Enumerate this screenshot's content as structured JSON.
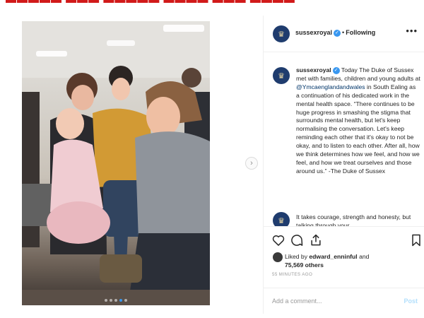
{
  "post": {
    "carousel": {
      "slide_count": 5,
      "active_index": 3
    }
  },
  "header": {
    "username": "sussexroyal",
    "separator": "•",
    "follow_state": "Following",
    "more_glyph": "•••",
    "avatar_glyph": "♛"
  },
  "caption": {
    "username": "sussexroyal",
    "text_before_mention": " Today The Duke of Sussex met with families, children and young adults at ",
    "mention": "@Ymcaenglandandwales",
    "text_after_mention": " in South Ealing as a continuation of his dedicated work in the mental health space. “There continues to be huge progress in smashing the stigma that surrounds mental health, but let's keep normalising the conversation. Let's keep reminding each other that it's okay to not be okay, and to listen to each other. After all, how we think determines how we feel, and how we feel, and how we treat ourselves and those around us.” -The Duke of Sussex"
  },
  "comment": {
    "text": "It takes courage, strength and honesty, but talking through your"
  },
  "likes": {
    "prefix": "Liked by ",
    "user": "edward_enninful",
    "joiner": " and",
    "count": "75,569 others"
  },
  "timestamp": "55 MINUTES AGO",
  "add_comment": {
    "placeholder": "Add a comment...",
    "post_label": "Post"
  },
  "icons": {
    "verified": "verified-badge-icon",
    "next": "chevron-right-icon",
    "like": "heart-icon",
    "comment": "comment-icon",
    "share": "share-icon",
    "save": "bookmark-icon"
  },
  "colors": {
    "link": "#003569",
    "verified": "#3897f0",
    "post_disabled": "#b2dffc",
    "timestamp": "#999999"
  }
}
